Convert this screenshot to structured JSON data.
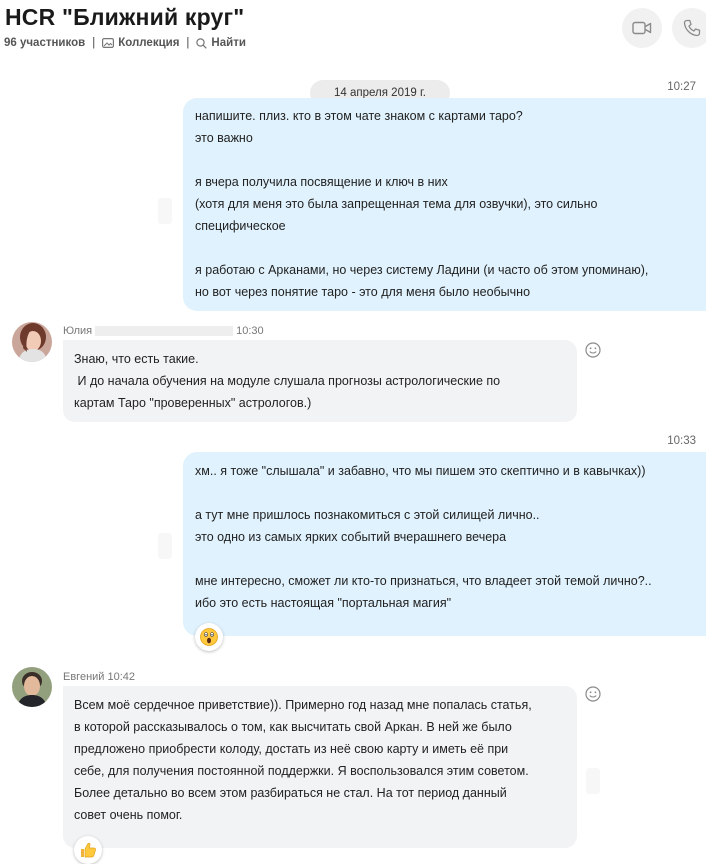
{
  "header": {
    "title": "HCR \"Ближний круг\"",
    "participants": "96 участников",
    "collection": "Коллекция",
    "search": "Найти"
  },
  "messages": {
    "date": "14 апреля 2019 г.",
    "m1": {
      "time": "10:27",
      "text": "напишите. плиз. кто в этом чате знаком с картами таро?\nэто важно\n\nя вчера получила посвящение и ключ в них\n(хотя для меня это была запрещенная тема для озвучки), это сильно\nспецифическое\n\nя работаю с Арканами, но через систему Ладини (и часто об этом упоминаю),\nно вот через понятие таро - это для меня было необычно"
    },
    "m2": {
      "sender": "Юлия",
      "time": "10:30",
      "text": "Знаю, что есть такие.\n И до начала обучения на модуле слушала прогнозы астрологические по\nкартам Таро \"проверенных\" астрологов.)"
    },
    "m3": {
      "time": "10:33",
      "text": "хм.. я тоже \"слышала\" и забавно, что мы пишем это скептично и в кавычках))\n\nа тут мне пришлось познакомиться с этой силищей лично..\nэто одно из самых ярких событий вчерашнего вечера\n\nмне интересно, сможет ли кто-то признаться, что владеет этой темой лично?..\nибо это есть настоящая \"портальная магия\""
    },
    "m4": {
      "sender": "Евгений",
      "time": "10:42",
      "text": "Всем моё сердечное приветствие)). Примерно год назад мне попалась статья,\nв которой рассказывалось о том, как высчитать свой Аркан. В ней же было\nпредложено приобрести колоду, достать из неё свою карту и иметь её при\nсебе, для получения постоянной поддержки. Я воспользовался этим советом.\nБолее детально во всем этом разбираться не стал. На тот период данный\nсовет очень помог."
    }
  },
  "icons": [
    "video-call-icon",
    "audio-call-icon",
    "gallery-icon",
    "search-icon",
    "smiley-icon",
    "surprised-emoji-icon",
    "thumbs-up-icon"
  ],
  "colors": {
    "outgoing_bubble": "#e0f2fd",
    "incoming_bubble": "#f2f3f5",
    "accent": "#00aff0"
  }
}
